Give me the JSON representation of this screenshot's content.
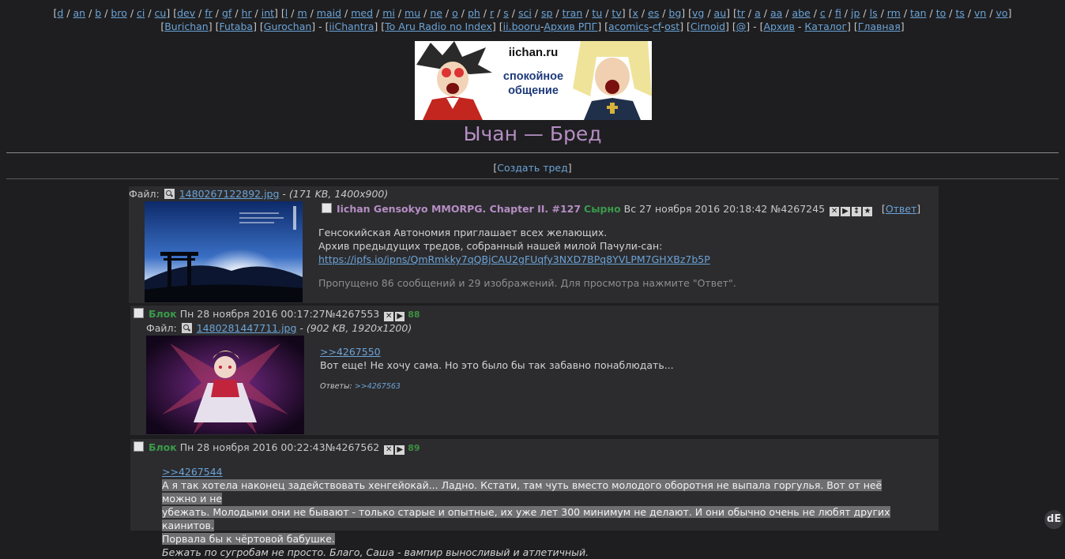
{
  "nav": {
    "boards": [
      "d",
      "an",
      "b",
      "bro",
      "ci",
      "cu",
      "dev",
      "fr",
      "gf",
      "hr",
      "int",
      "l",
      "m",
      "maid",
      "med",
      "mi",
      "mu",
      "ne",
      "o",
      "ph",
      "r",
      "s",
      "sci",
      "sp",
      "tran",
      "tu",
      "tv",
      "x",
      "es",
      "bg",
      "vg",
      "au",
      "tr",
      "a",
      "aa",
      "abe",
      "c",
      "fi",
      "jp",
      "ls",
      "rm",
      "tan",
      "to",
      "ts",
      "vn",
      "vo"
    ],
    "groups_after": [
      6,
      11,
      27,
      30,
      32
    ],
    "links2": [
      "Burichan",
      "Futaba",
      "Gurochan",
      "iiChantra",
      "To Aru Radio no Index",
      "ii.booru",
      "Архив РПГ",
      "acomics",
      "cf",
      "ost",
      "Cirnoid",
      "@",
      "Архив",
      "Каталог",
      "Главная"
    ]
  },
  "banner": {
    "site": "iichan.ru",
    "tagline_1": "спокойное",
    "tagline_2": "общение"
  },
  "board_title": "Ычан — Бред",
  "create_thread": "Создать тред",
  "op": {
    "file_label": "Файл:",
    "file_name": "1480267122892.jpg",
    "file_info": "(171 KB, 1400x900)",
    "subject": "Iichan Gensokyo MMORPG. Chapter II. #127",
    "name": "Сырно",
    "date": "Вс 27 ноября 2016 20:18:42",
    "post_no": "№4267245",
    "reply_link": "Ответ",
    "line1": "Генсокийская Автономия приглашает всех желающих.",
    "line2": "Архив предыдущих тредов, собранный нашей милой Пачули-сан:",
    "url": "https://ipfs.io/ipns/QmRmkky7qQBjCAU2gFUqfy3NXD7BPq8YVLPM7GHXBz7b5P",
    "omitted": "Пропущено 86 сообщений и 29 изображений. Для просмотра нажмите \"Ответ\"."
  },
  "reply1": {
    "name": "Блок",
    "date": "Пн 28 ноября 2016 00:17:27",
    "post_no": "№4267553",
    "count": "88",
    "file_label": "Файл:",
    "file_name": "1480281447711.jpg",
    "file_info": "(902 KB, 1920x1200)",
    "quote": ">>4267550",
    "text": "Вот еще! Не хочу сама. Но это было бы так забавно понаблюдать...",
    "replies_label": "Ответы:",
    "replies_link": ">>4267563"
  },
  "reply2": {
    "name": "Блок",
    "date": "Пн 28 ноября 2016 00:22:43",
    "post_no": "№4267562",
    "count": "89",
    "quote": ">>4267544",
    "line1": "А я так хотела наконец задействовать хенгейокай... Ладно. Кстати, там чуть вместо молодого оборотня не выпала горгулья. Вот от неё можно и не",
    "line2": "убежать. Молодыми они не бывают - только старые и опытные, их уже лет 300 минимум не делают. И они обычно очень не любят других каинитов.",
    "line3": "Порвала бы к чёртовой бабушке.",
    "line4": "Бежать по сугробам не просто. Благо, Саша - вампир выносливый и атлетичный."
  },
  "corner_badge": "dE",
  "colors": {
    "background": "#1e1e20",
    "post_bg": "#2c2c2f",
    "link": "#6ba3d6",
    "subject": "#b58ec4",
    "name": "#3a9a4a"
  }
}
